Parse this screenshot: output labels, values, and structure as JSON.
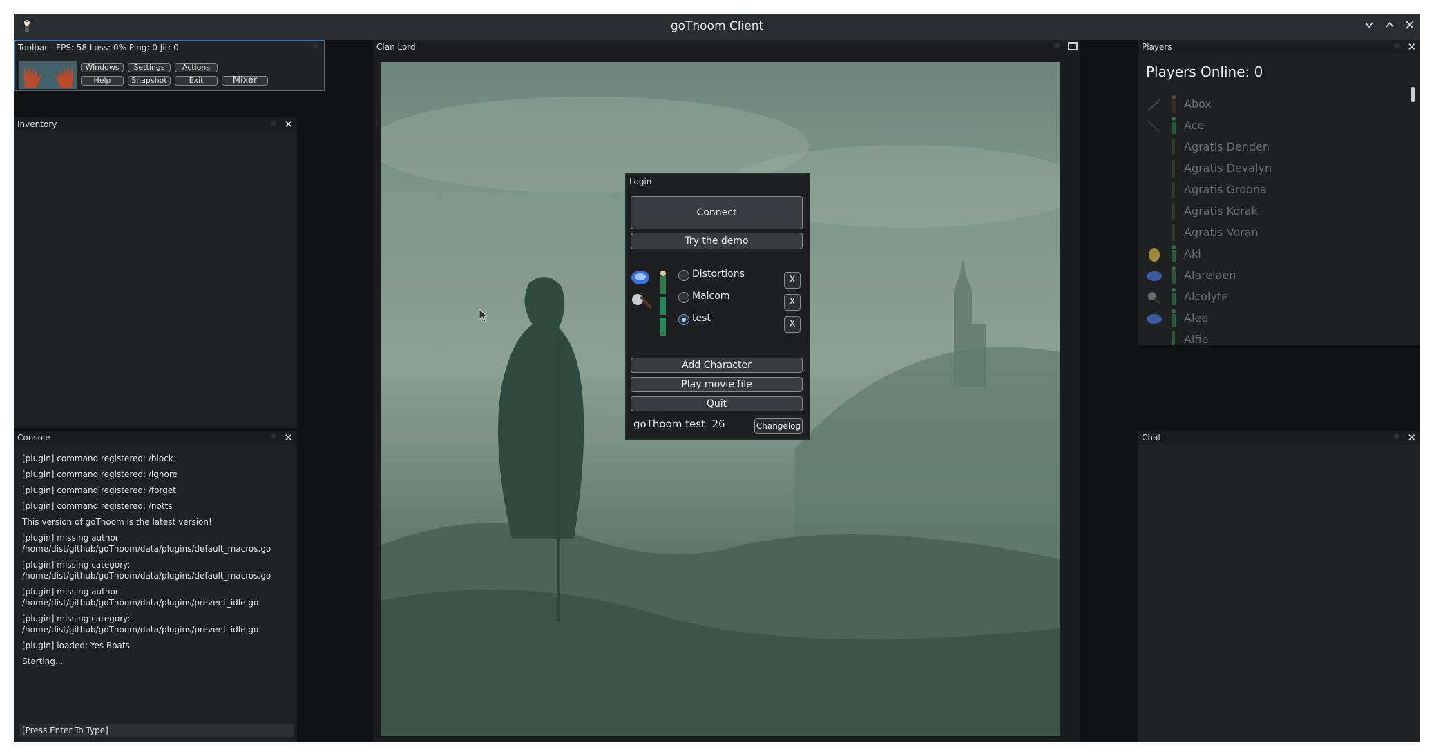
{
  "window": {
    "title": "goThoom Client",
    "controls": [
      "minimize",
      "maximize",
      "close"
    ]
  },
  "toolbar": {
    "title": "Toolbar - FPS:  58 Loss: 0% Ping: 0   Jit: 0",
    "buttons": {
      "windows": "Windows",
      "settings": "Settings",
      "actions": "Actions",
      "help": "Help",
      "snapshot": "Snapshot",
      "exit": "Exit",
      "mixer": "Mixer"
    }
  },
  "inventory": {
    "title": "Inventory"
  },
  "console": {
    "title": "Console",
    "lines": [
      "[plugin] command registered: /block",
      "[plugin] command registered: /ignore",
      "[plugin] command registered: /forget",
      "[plugin] command registered: /notts",
      "This version of goThoom is the latest version!",
      "[plugin] missing author:\n/home/dist/github/goThoom/data/plugins/default_macros.go",
      "[plugin] missing category:\n/home/dist/github/goThoom/data/plugins/default_macros.go",
      "[plugin] missing author:\n/home/dist/github/goThoom/data/plugins/prevent_idle.go",
      "[plugin] missing category:\n/home/dist/github/goThoom/data/plugins/prevent_idle.go",
      "[plugin] loaded: Yes Boats",
      "Starting..."
    ],
    "input_placeholder": "[Press Enter To Type]"
  },
  "game": {
    "title": "Clan Lord"
  },
  "login": {
    "title": "Login",
    "connect": "Connect",
    "demo": "Try the demo",
    "characters": [
      {
        "name": "Distortions",
        "selected": false,
        "remove": "X"
      },
      {
        "name": "Malcom",
        "selected": false,
        "remove": "X"
      },
      {
        "name": "test",
        "selected": true,
        "remove": "X"
      }
    ],
    "add_character": "Add Character",
    "play_movie": "Play movie file",
    "quit": "Quit",
    "version_label": "goThoom test",
    "version_number": "26",
    "changelog": "Changelog"
  },
  "players": {
    "title": "Players",
    "online_label": "Players Online: 0",
    "list": [
      "Abox",
      "Ace",
      "Agratis Denden",
      "Agratis Devalyn",
      "Agratis Groona",
      "Agratis Korak",
      "Agratis Voran",
      "Aki",
      "Alarelaen",
      "Alcolyte",
      "Alee",
      "Alfie"
    ]
  },
  "chat": {
    "title": "Chat"
  },
  "colors": {
    "panel": "#1f2123",
    "accent": "#4ea0e8",
    "faded_name": "#6b6e70"
  }
}
